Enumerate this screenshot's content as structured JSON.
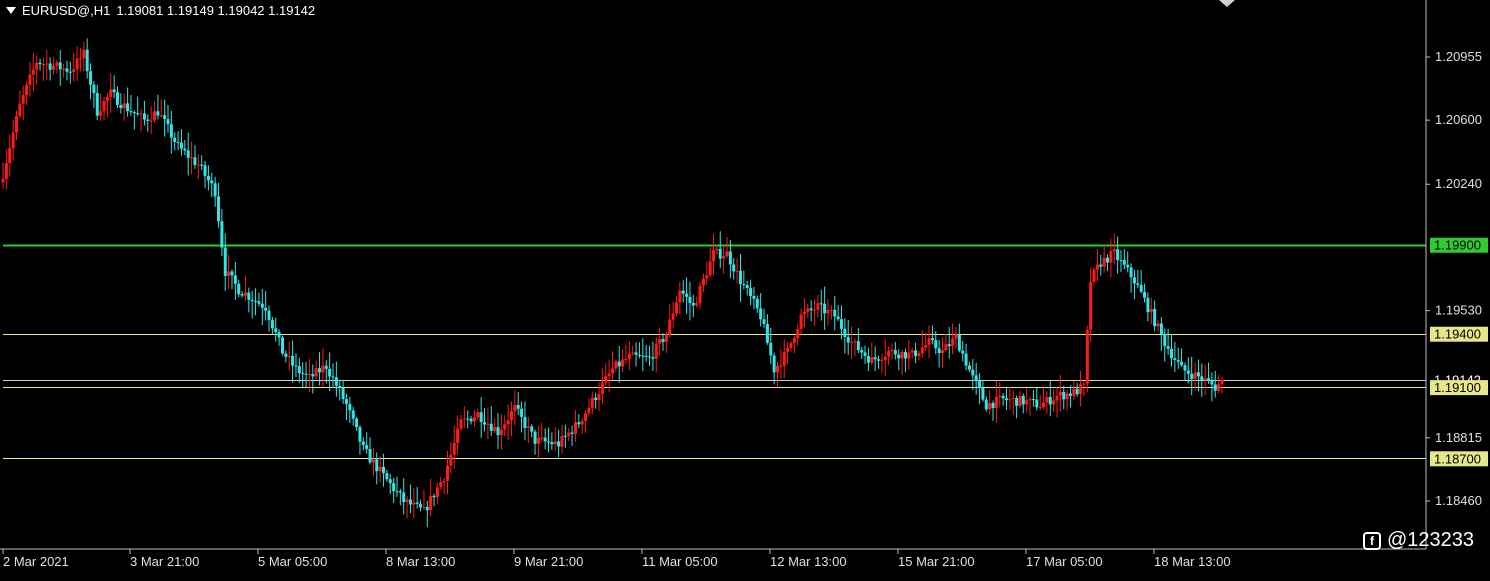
{
  "header": {
    "symbol": "EURUSD@,H1",
    "ohlc": "1.19081 1.19149 1.19042 1.19142"
  },
  "watermark": {
    "handle": "@123233",
    "icon": "feed-icon"
  },
  "colors": {
    "background": "#000000",
    "bull": "#ff1a1a",
    "bear": "#33e6e6",
    "axis": "#c0c0c0",
    "line_green": "#2ecc2e",
    "line_yellow": "#e6e68a",
    "line_white": "#d0d0d0"
  },
  "chart_data": {
    "type": "candlestick",
    "ylim": [
      1.1826,
      1.212
    ],
    "price_ticks": [
      "1.20955",
      "1.20600",
      "1.20240",
      "1.19530",
      "1.18815",
      "1.18460"
    ],
    "time_ticks": [
      "2 Mar 2021",
      "3 Mar 21:00",
      "5 Mar 05:00",
      "8 Mar 13:00",
      "9 Mar 21:00",
      "11 Mar 05:00",
      "12 Mar 13:00",
      "15 Mar 21:00",
      "17 Mar 05:00",
      "18 Mar 13:00"
    ],
    "levels": [
      {
        "price": 1.199,
        "label": "1.19900",
        "color": "#2ecc2e"
      },
      {
        "price": 1.194,
        "label": "1.19400",
        "color": "#e6e68a"
      },
      {
        "price": 1.19142,
        "label": "1.19142",
        "color": "#d0d0d0"
      },
      {
        "price": 1.191,
        "label": "1.19100",
        "color": "#e6e68a"
      },
      {
        "price": 1.187,
        "label": "1.18700",
        "color": "#e6e68a"
      }
    ],
    "close_path": [
      [
        0,
        1.203
      ],
      [
        5,
        1.2068
      ],
      [
        10,
        1.2093
      ],
      [
        20,
        1.2088
      ],
      [
        24,
        1.2097
      ],
      [
        28,
        1.2065
      ],
      [
        32,
        1.2075
      ],
      [
        36,
        1.2068
      ],
      [
        42,
        1.206
      ],
      [
        46,
        1.2065
      ],
      [
        52,
        1.2045
      ],
      [
        58,
        1.2035
      ],
      [
        63,
        1.202
      ],
      [
        66,
        1.1975
      ],
      [
        70,
        1.1965
      ],
      [
        78,
        1.1955
      ],
      [
        83,
        1.193
      ],
      [
        87,
        1.192
      ],
      [
        91,
        1.1915
      ],
      [
        96,
        1.1922
      ],
      [
        102,
        1.19
      ],
      [
        107,
        1.1875
      ],
      [
        113,
        1.186
      ],
      [
        119,
        1.1846
      ],
      [
        125,
        1.184
      ],
      [
        131,
        1.186
      ],
      [
        136,
        1.189
      ],
      [
        141,
        1.1895
      ],
      [
        147,
        1.1885
      ],
      [
        152,
        1.1898
      ],
      [
        158,
        1.188
      ],
      [
        165,
        1.1878
      ],
      [
        171,
        1.189
      ],
      [
        176,
        1.1905
      ],
      [
        181,
        1.192
      ],
      [
        186,
        1.1927
      ],
      [
        192,
        1.1926
      ],
      [
        197,
        1.194
      ],
      [
        201,
        1.1965
      ],
      [
        205,
        1.1955
      ],
      [
        208,
        1.197
      ],
      [
        211,
        1.1985
      ],
      [
        215,
        1.1985
      ],
      [
        219,
        1.197
      ],
      [
        225,
        1.195
      ],
      [
        229,
        1.192
      ],
      [
        233,
        1.193
      ],
      [
        237,
        1.195
      ],
      [
        242,
        1.1955
      ],
      [
        247,
        1.195
      ],
      [
        252,
        1.1935
      ],
      [
        258,
        1.1925
      ],
      [
        263,
        1.193
      ],
      [
        270,
        1.1928
      ],
      [
        275,
        1.1935
      ],
      [
        279,
        1.193
      ],
      [
        283,
        1.1938
      ],
      [
        288,
        1.1915
      ],
      [
        292,
        1.19
      ],
      [
        297,
        1.1903
      ],
      [
        303,
        1.1902
      ],
      [
        308,
        1.19
      ],
      [
        313,
        1.1905
      ],
      [
        318,
        1.1907
      ],
      [
        321,
        1.191
      ],
      [
        323,
        1.197
      ],
      [
        326,
        1.198
      ],
      [
        330,
        1.1985
      ],
      [
        336,
        1.197
      ],
      [
        340,
        1.1955
      ],
      [
        345,
        1.1935
      ],
      [
        350,
        1.192
      ],
      [
        356,
        1.1915
      ],
      [
        360,
        1.191
      ],
      [
        362,
        1.1913
      ]
    ],
    "bars": 362
  }
}
